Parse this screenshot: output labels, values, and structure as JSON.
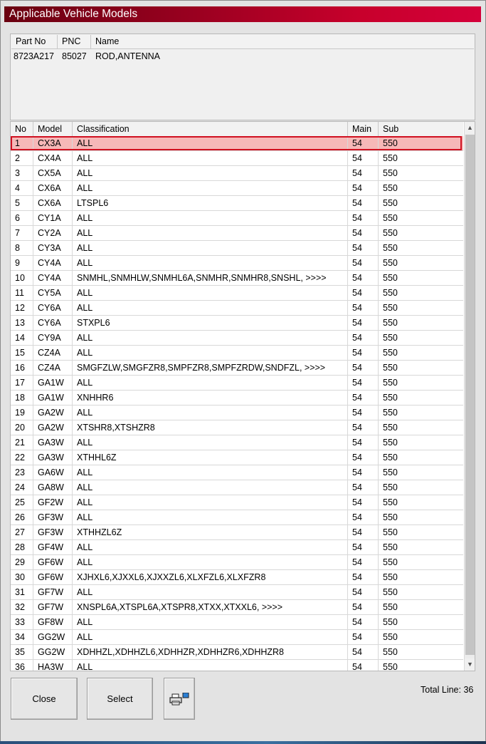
{
  "window": {
    "title": "Applicable Vehicle Models"
  },
  "part": {
    "headers": [
      "Part No",
      "PNC",
      "Name"
    ],
    "row": {
      "part_no": "8723A217",
      "pnc": "85027",
      "name": "ROD,ANTENNA"
    }
  },
  "grid": {
    "headers": {
      "no": "No",
      "model": "Model",
      "classification": "Classification",
      "main": "Main",
      "sub": "Sub"
    },
    "selected_index": 0,
    "rows": [
      {
        "no": "1",
        "model": "CX3A",
        "classification": "ALL",
        "main": "54",
        "sub": "550"
      },
      {
        "no": "2",
        "model": "CX4A",
        "classification": "ALL",
        "main": "54",
        "sub": "550"
      },
      {
        "no": "3",
        "model": "CX5A",
        "classification": "ALL",
        "main": "54",
        "sub": "550"
      },
      {
        "no": "4",
        "model": "CX6A",
        "classification": "ALL",
        "main": "54",
        "sub": "550"
      },
      {
        "no": "5",
        "model": "CX6A",
        "classification": "LTSPL6",
        "main": "54",
        "sub": "550"
      },
      {
        "no": "6",
        "model": "CY1A",
        "classification": "ALL",
        "main": "54",
        "sub": "550"
      },
      {
        "no": "7",
        "model": "CY2A",
        "classification": "ALL",
        "main": "54",
        "sub": "550"
      },
      {
        "no": "8",
        "model": "CY3A",
        "classification": "ALL",
        "main": "54",
        "sub": "550"
      },
      {
        "no": "9",
        "model": "CY4A",
        "classification": "ALL",
        "main": "54",
        "sub": "550"
      },
      {
        "no": "10",
        "model": "CY4A",
        "classification": "SNMHL,SNMHLW,SNMHL6A,SNMHR,SNMHR8,SNSHL,  >>>>",
        "main": "54",
        "sub": "550"
      },
      {
        "no": "11",
        "model": "CY5A",
        "classification": "ALL",
        "main": "54",
        "sub": "550"
      },
      {
        "no": "12",
        "model": "CY6A",
        "classification": "ALL",
        "main": "54",
        "sub": "550"
      },
      {
        "no": "13",
        "model": "CY6A",
        "classification": "STXPL6",
        "main": "54",
        "sub": "550"
      },
      {
        "no": "14",
        "model": "CY9A",
        "classification": "ALL",
        "main": "54",
        "sub": "550"
      },
      {
        "no": "15",
        "model": "CZ4A",
        "classification": "ALL",
        "main": "54",
        "sub": "550"
      },
      {
        "no": "16",
        "model": "CZ4A",
        "classification": "SMGFZLW,SMGFZR8,SMPFZR8,SMPFZRDW,SNDFZL,  >>>>",
        "main": "54",
        "sub": "550"
      },
      {
        "no": "17",
        "model": "GA1W",
        "classification": "ALL",
        "main": "54",
        "sub": "550"
      },
      {
        "no": "18",
        "model": "GA1W",
        "classification": "XNHHR6",
        "main": "54",
        "sub": "550"
      },
      {
        "no": "19",
        "model": "GA2W",
        "classification": "ALL",
        "main": "54",
        "sub": "550"
      },
      {
        "no": "20",
        "model": "GA2W",
        "classification": "XTSHR8,XTSHZR8",
        "main": "54",
        "sub": "550"
      },
      {
        "no": "21",
        "model": "GA3W",
        "classification": "ALL",
        "main": "54",
        "sub": "550"
      },
      {
        "no": "22",
        "model": "GA3W",
        "classification": "XTHHL6Z",
        "main": "54",
        "sub": "550"
      },
      {
        "no": "23",
        "model": "GA6W",
        "classification": "ALL",
        "main": "54",
        "sub": "550"
      },
      {
        "no": "24",
        "model": "GA8W",
        "classification": "ALL",
        "main": "54",
        "sub": "550"
      },
      {
        "no": "25",
        "model": "GF2W",
        "classification": "ALL",
        "main": "54",
        "sub": "550"
      },
      {
        "no": "26",
        "model": "GF3W",
        "classification": "ALL",
        "main": "54",
        "sub": "550"
      },
      {
        "no": "27",
        "model": "GF3W",
        "classification": "XTHHZL6Z",
        "main": "54",
        "sub": "550"
      },
      {
        "no": "28",
        "model": "GF4W",
        "classification": "ALL",
        "main": "54",
        "sub": "550"
      },
      {
        "no": "29",
        "model": "GF6W",
        "classification": "ALL",
        "main": "54",
        "sub": "550"
      },
      {
        "no": "30",
        "model": "GF6W",
        "classification": "XJHXL6,XJXXL6,XJXXZL6,XLXFZL6,XLXFZR8",
        "main": "54",
        "sub": "550"
      },
      {
        "no": "31",
        "model": "GF7W",
        "classification": "ALL",
        "main": "54",
        "sub": "550"
      },
      {
        "no": "32",
        "model": "GF7W",
        "classification": "XNSPL6A,XTSPL6A,XTSPR8,XTXX,XTXXL6,  >>>>",
        "main": "54",
        "sub": "550"
      },
      {
        "no": "33",
        "model": "GF8W",
        "classification": "ALL",
        "main": "54",
        "sub": "550"
      },
      {
        "no": "34",
        "model": "GG2W",
        "classification": "ALL",
        "main": "54",
        "sub": "550"
      },
      {
        "no": "35",
        "model": "GG2W",
        "classification": "XDHHZL,XDHHZL6,XDHHZR,XDHHZR6,XDHHZR8",
        "main": "54",
        "sub": "550"
      },
      {
        "no": "36",
        "model": "HA3W",
        "classification": "ALL",
        "main": "54",
        "sub": "550"
      }
    ]
  },
  "buttons": {
    "close": "Close",
    "select": "Select",
    "print_icon": "printer-icon"
  },
  "footer": {
    "total_line": "Total Line: 36"
  },
  "colors": {
    "title_start": "#6a0010",
    "title_end": "#d4003a",
    "selection_fill": "#f6b8b8",
    "selection_border": "#d01020"
  }
}
